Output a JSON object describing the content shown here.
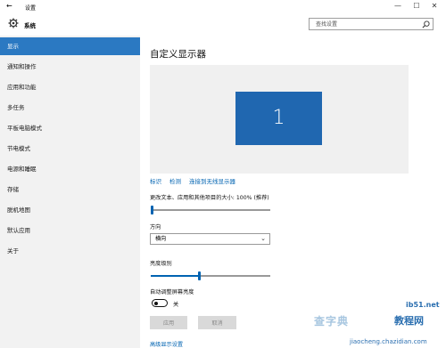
{
  "window": {
    "back_glyph": "←",
    "title": "设置",
    "minimize": "—",
    "maximize": "☐",
    "close": "✕"
  },
  "header": {
    "section": "系统",
    "search_placeholder": "查找设置"
  },
  "sidebar": {
    "items": [
      {
        "label": "显示",
        "active": true
      },
      {
        "label": "通知和操作"
      },
      {
        "label": "应用和功能"
      },
      {
        "label": "多任务"
      },
      {
        "label": "平板电脑模式"
      },
      {
        "label": "节电模式"
      },
      {
        "label": "电源和睡眠"
      },
      {
        "label": "存储"
      },
      {
        "label": "脱机地图"
      },
      {
        "label": "默认应用"
      },
      {
        "label": "关于"
      }
    ]
  },
  "main": {
    "title": "自定义显示器",
    "monitor_number": "1",
    "links": {
      "identify": "标识",
      "detect": "检测",
      "connect": "连接到无线显示器"
    },
    "scale_label": "更改文本、应用和其他项目的大小: 100% (推荐)",
    "scale_value_fraction": 0.0,
    "orientation_label": "方向",
    "orientation_value": "横向",
    "brightness_label": "亮度级别",
    "brightness_value_fraction": 0.4,
    "auto_brightness_label": "自动调整屏幕亮度",
    "auto_brightness_state": "关",
    "apply_label": "应用",
    "cancel_label": "取消",
    "advanced_link": "高级显示设置"
  },
  "watermark": {
    "site_zh": "查字典",
    "site_zh2": "教程网",
    "url": "jiaocheng.chazidian.com",
    "ib51": "ib51.net"
  },
  "colors": {
    "accent": "#2b79c2",
    "monitor": "#2067b0",
    "link": "#0063b1"
  }
}
